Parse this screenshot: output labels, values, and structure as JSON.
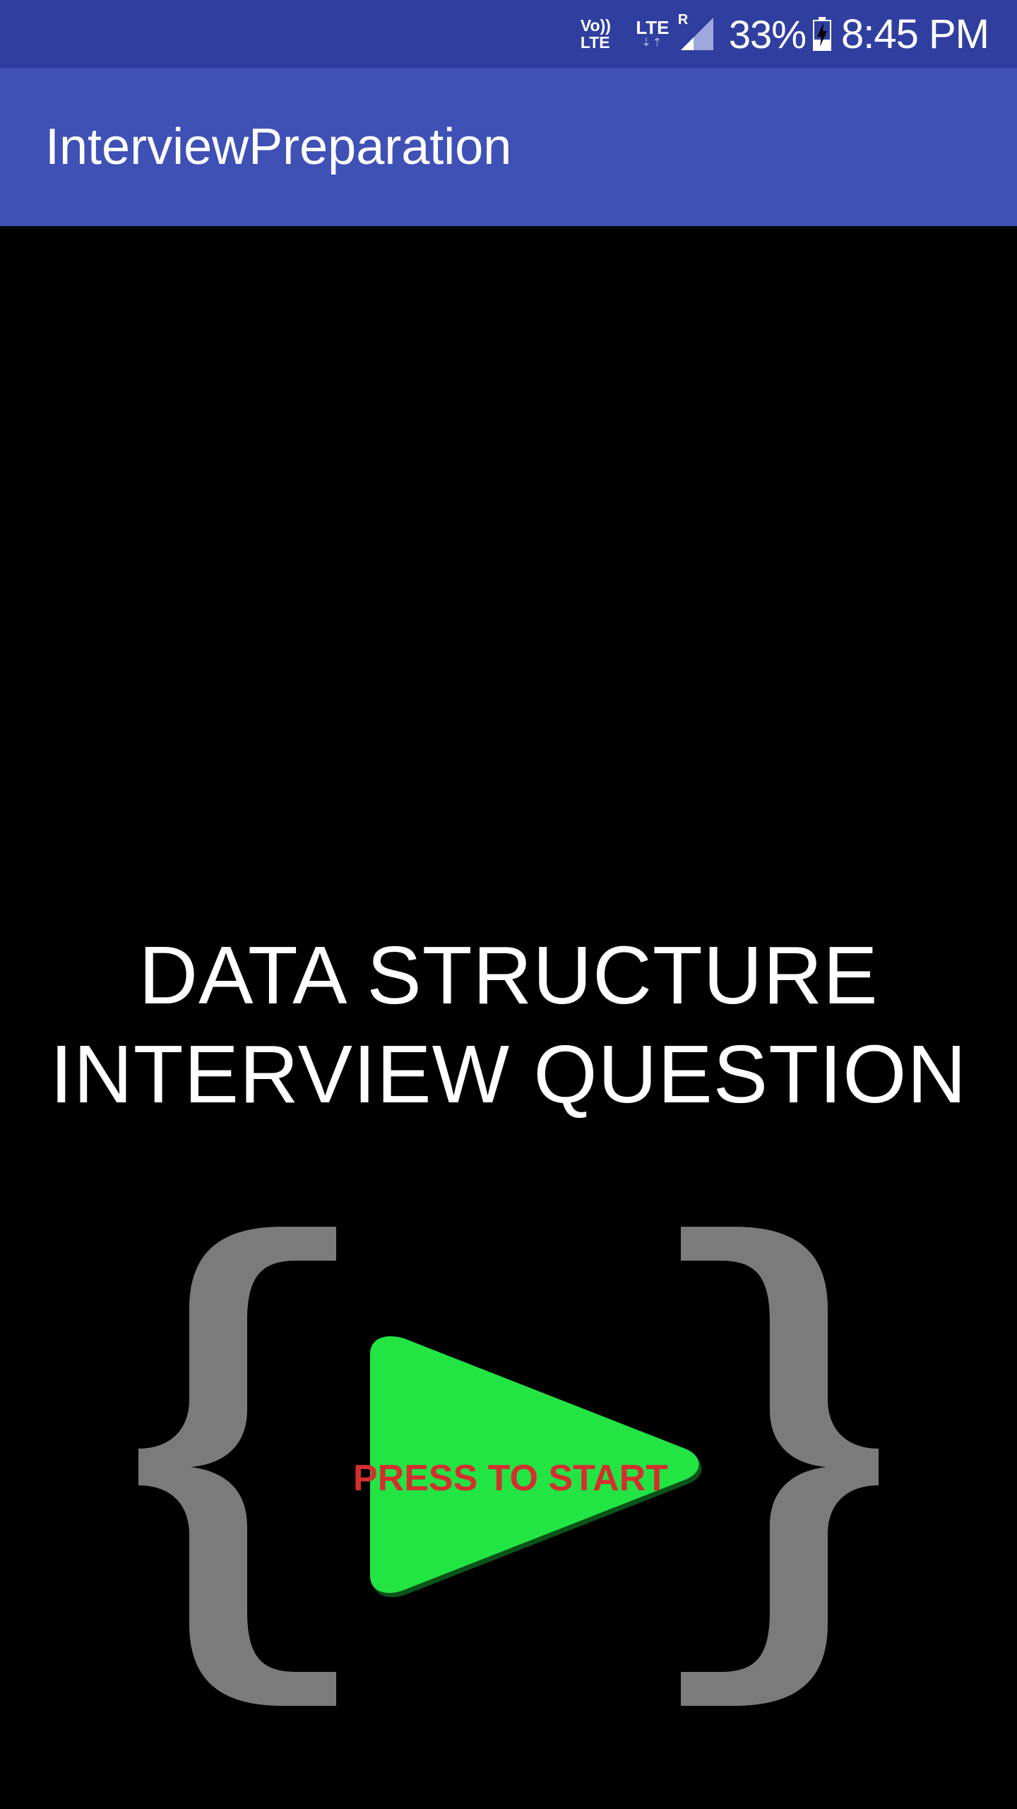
{
  "status_bar": {
    "volte_top": "Vo))",
    "volte_bottom": "LTE",
    "network_type": "LTE",
    "data_arrows": "⇣⇡",
    "roaming": "R",
    "signal_icon": "signal-icon",
    "battery_percent": "33%",
    "battery_icon": "battery-charging-icon",
    "time": "8:45 PM"
  },
  "app_bar": {
    "title": "InterviewPreparation"
  },
  "main": {
    "headline_line1": "DATA STRUCTURE",
    "headline_line2": "INTERVIEW QUESTION",
    "start_label": "PRESS TO START",
    "logo_icon": "curly-braces-play-icon"
  },
  "colors": {
    "status_bar": "#303F9F",
    "app_bar": "#3F51B5",
    "background": "#000000",
    "brace": "#7B7B7B",
    "play": "#22E544",
    "start_text": "#D32F2F"
  }
}
